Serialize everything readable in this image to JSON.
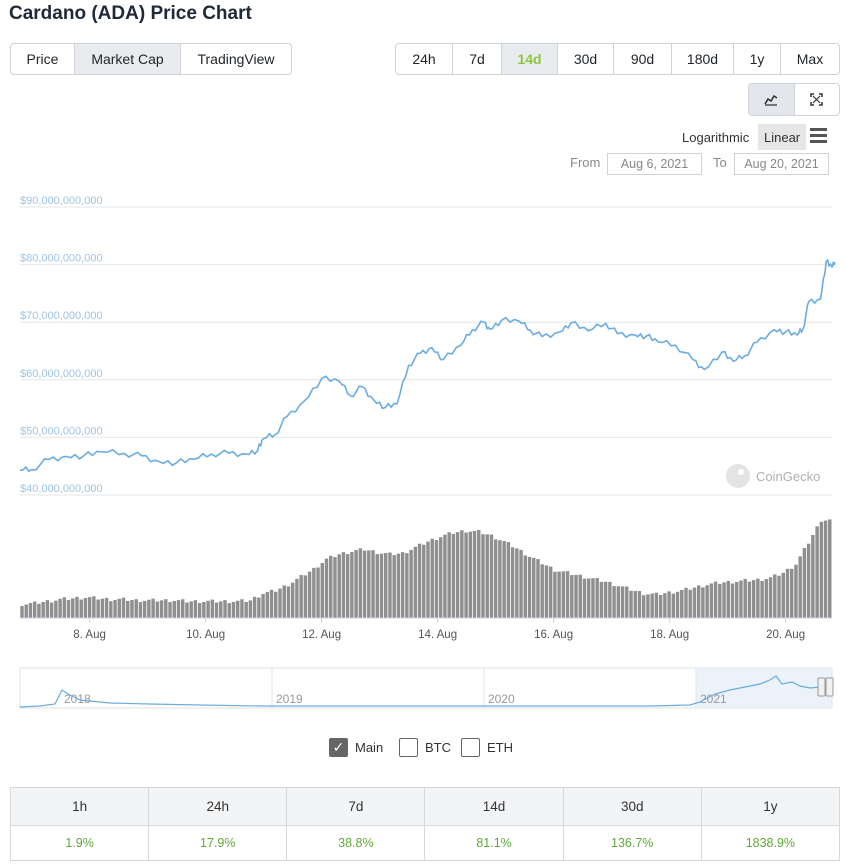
{
  "title": "Cardano (ADA) Price Chart",
  "view_tabs": [
    {
      "label": "Price",
      "active": false
    },
    {
      "label": "Market Cap",
      "active": true
    },
    {
      "label": "TradingView",
      "active": false
    }
  ],
  "range_tabs": [
    {
      "label": "24h",
      "active": false
    },
    {
      "label": "7d",
      "active": false
    },
    {
      "label": "14d",
      "active": true
    },
    {
      "label": "30d",
      "active": false
    },
    {
      "label": "90d",
      "active": false
    },
    {
      "label": "180d",
      "active": false
    },
    {
      "label": "1y",
      "active": false
    },
    {
      "label": "Max",
      "active": false
    }
  ],
  "chart_type_icons": [
    "line-chart-icon",
    "fullscreen-icon"
  ],
  "scale": {
    "log_label": "Logarithmic",
    "linear_label": "Linear",
    "selected": "linear"
  },
  "date_range": {
    "from_label": "From",
    "from_value": "Aug 6, 2021",
    "to_label": "To",
    "to_value": "Aug 20, 2021"
  },
  "watermark": "CoinGecko",
  "colors": {
    "line": "#6aace2",
    "bars": "#8f8f8f",
    "accent": "#8dc63f",
    "positive": "#61a83b"
  },
  "chart_data": {
    "type": "line",
    "title": "",
    "xlabel": "",
    "ylabel": "",
    "ylim": [
      40000000000,
      90000000000
    ],
    "y_ticks": [
      {
        "value": 90000000000,
        "label": "$90,000,000,000"
      },
      {
        "value": 80000000000,
        "label": "$80,000,000,000"
      },
      {
        "value": 70000000000,
        "label": "$70,000,000,000"
      },
      {
        "value": 60000000000,
        "label": "$60,000,000,000"
      },
      {
        "value": 50000000000,
        "label": "$50,000,000,000"
      },
      {
        "value": 40000000000,
        "label": "$40,000,000,000"
      }
    ],
    "x_range_days": [
      6.8,
      20.8
    ],
    "x_ticks": [
      {
        "day": 8,
        "label": "8. Aug"
      },
      {
        "day": 10,
        "label": "10. Aug"
      },
      {
        "day": 12,
        "label": "12. Aug"
      },
      {
        "day": 14,
        "label": "14. Aug"
      },
      {
        "day": 16,
        "label": "16. Aug"
      },
      {
        "day": 18,
        "label": "18. Aug"
      },
      {
        "day": 20,
        "label": "20. Aug"
      }
    ],
    "series": [
      {
        "values_per_day": [
          [
            6.8,
            44300000000
          ],
          [
            7.0,
            44400000000
          ],
          [
            7.3,
            46200000000
          ],
          [
            7.6,
            46700000000
          ],
          [
            7.9,
            46800000000
          ],
          [
            8.2,
            47500000000
          ],
          [
            8.6,
            47200000000
          ],
          [
            8.9,
            46800000000
          ],
          [
            9.2,
            45800000000
          ],
          [
            9.5,
            45600000000
          ],
          [
            9.8,
            46200000000
          ],
          [
            10.1,
            47100000000
          ],
          [
            10.4,
            47300000000
          ],
          [
            10.7,
            47100000000
          ],
          [
            10.9,
            47800000000
          ],
          [
            11.0,
            49800000000
          ],
          [
            11.2,
            50500000000
          ],
          [
            11.4,
            53600000000
          ],
          [
            11.7,
            56300000000
          ],
          [
            12.0,
            60200000000
          ],
          [
            12.3,
            59800000000
          ],
          [
            12.5,
            57200000000
          ],
          [
            12.7,
            58800000000
          ],
          [
            12.9,
            56500000000
          ],
          [
            13.1,
            55200000000
          ],
          [
            13.3,
            55800000000
          ],
          [
            13.5,
            62500000000
          ],
          [
            13.7,
            64600000000
          ],
          [
            13.9,
            65600000000
          ],
          [
            14.1,
            63500000000
          ],
          [
            14.4,
            66000000000
          ],
          [
            14.6,
            68700000000
          ],
          [
            14.8,
            70000000000
          ],
          [
            14.9,
            68800000000
          ],
          [
            15.1,
            70300000000
          ],
          [
            15.4,
            70200000000
          ],
          [
            15.6,
            68600000000
          ],
          [
            15.8,
            67500000000
          ],
          [
            16.1,
            68300000000
          ],
          [
            16.3,
            69900000000
          ],
          [
            16.6,
            68500000000
          ],
          [
            16.9,
            69800000000
          ],
          [
            17.1,
            68000000000
          ],
          [
            17.4,
            67800000000
          ],
          [
            17.6,
            67600000000
          ],
          [
            17.8,
            66600000000
          ],
          [
            18.1,
            66000000000
          ],
          [
            18.4,
            63500000000
          ],
          [
            18.6,
            61800000000
          ],
          [
            18.9,
            64800000000
          ],
          [
            19.1,
            63200000000
          ],
          [
            19.3,
            64200000000
          ],
          [
            19.5,
            66500000000
          ],
          [
            19.8,
            68700000000
          ],
          [
            20.0,
            68300000000
          ],
          [
            20.2,
            67800000000
          ],
          [
            20.3,
            68800000000
          ],
          [
            20.4,
            73600000000
          ],
          [
            20.6,
            74000000000
          ],
          [
            20.7,
            80500000000
          ],
          [
            20.8,
            79600000000
          ],
          [
            20.85,
            80400000000
          ]
        ]
      }
    ],
    "volume_relative": [
      0.14,
      0.15,
      0.17,
      0.19,
      0.2,
      0.21,
      0.2,
      0.19,
      0.19,
      0.18,
      0.18,
      0.18,
      0.18,
      0.17,
      0.17,
      0.17,
      0.17,
      0.17,
      0.18,
      0.25,
      0.28,
      0.34,
      0.42,
      0.5,
      0.6,
      0.65,
      0.68,
      0.7,
      0.67,
      0.65,
      0.66,
      0.72,
      0.78,
      0.83,
      0.87,
      0.89,
      0.88,
      0.84,
      0.78,
      0.71,
      0.63,
      0.56,
      0.49,
      0.46,
      0.43,
      0.4,
      0.37,
      0.33,
      0.29,
      0.25,
      0.24,
      0.26,
      0.28,
      0.31,
      0.34,
      0.36,
      0.37,
      0.38,
      0.39,
      0.41,
      0.46,
      0.55,
      0.77,
      1.0
    ]
  },
  "navigator": {
    "year_labels": [
      "2018",
      "2019",
      "2020",
      "2021"
    ]
  },
  "legend": [
    {
      "label": "Main",
      "checked": true
    },
    {
      "label": "BTC",
      "checked": false
    },
    {
      "label": "ETH",
      "checked": false
    }
  ],
  "performance": {
    "headers": [
      "1h",
      "24h",
      "7d",
      "14d",
      "30d",
      "1y"
    ],
    "values": [
      "1.9%",
      "17.9%",
      "38.8%",
      "81.1%",
      "136.7%",
      "1838.9%"
    ]
  }
}
